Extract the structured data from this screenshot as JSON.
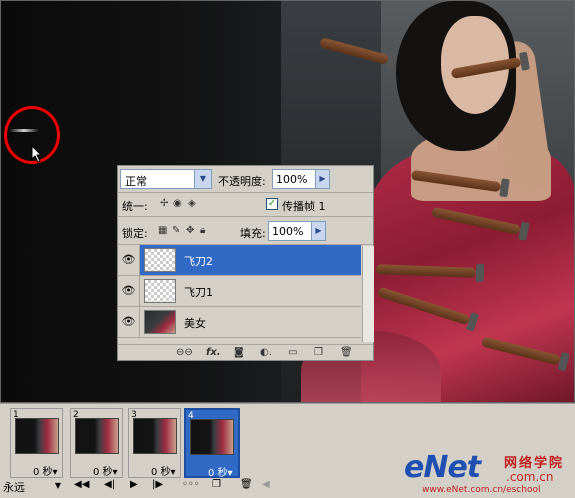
{
  "layers_panel": {
    "blend_mode": "正常",
    "opacity_label": "不透明度:",
    "opacity_value": "100%",
    "unify_label": "统一:",
    "propagate_label": "传播帧 1",
    "lock_label": "锁定:",
    "fill_label": "填充:",
    "fill_value": "100%",
    "layers": [
      {
        "name": "飞刀2",
        "selected": true,
        "thumb": "transparent"
      },
      {
        "name": "飞刀1",
        "selected": false,
        "thumb": "transparent"
      },
      {
        "name": "美女",
        "selected": false,
        "thumb": "photo"
      }
    ],
    "bottom_icons": [
      "link-icon",
      "fx-icon",
      "mask-icon",
      "adjustment-icon",
      "folder-icon",
      "new-layer-icon",
      "trash-icon"
    ],
    "fx_text": "fx."
  },
  "animation": {
    "frames": [
      {
        "num": "1",
        "delay": "0 秒",
        "selected": false
      },
      {
        "num": "2",
        "delay": "0 秒",
        "selected": false
      },
      {
        "num": "3",
        "delay": "0 秒",
        "selected": false
      },
      {
        "num": "4",
        "delay": "0 秒",
        "selected": true
      }
    ],
    "loop": "永远",
    "controls": [
      "first-frame-icon",
      "prev-frame-icon",
      "play-icon",
      "next-frame-icon",
      "tween-icon",
      "duplicate-frame-icon",
      "delete-frame-icon"
    ]
  },
  "watermark": {
    "logo": "eNet",
    "cn_title": "网络学院",
    "cn_domain": ".com.cn",
    "url": "www.eNet.com.cn/eschool"
  },
  "colors": {
    "selection": "#316ac5",
    "annotation_circle": "#e00000",
    "watermark_blue": "#1f4fb0",
    "watermark_red": "#c01f1f"
  }
}
